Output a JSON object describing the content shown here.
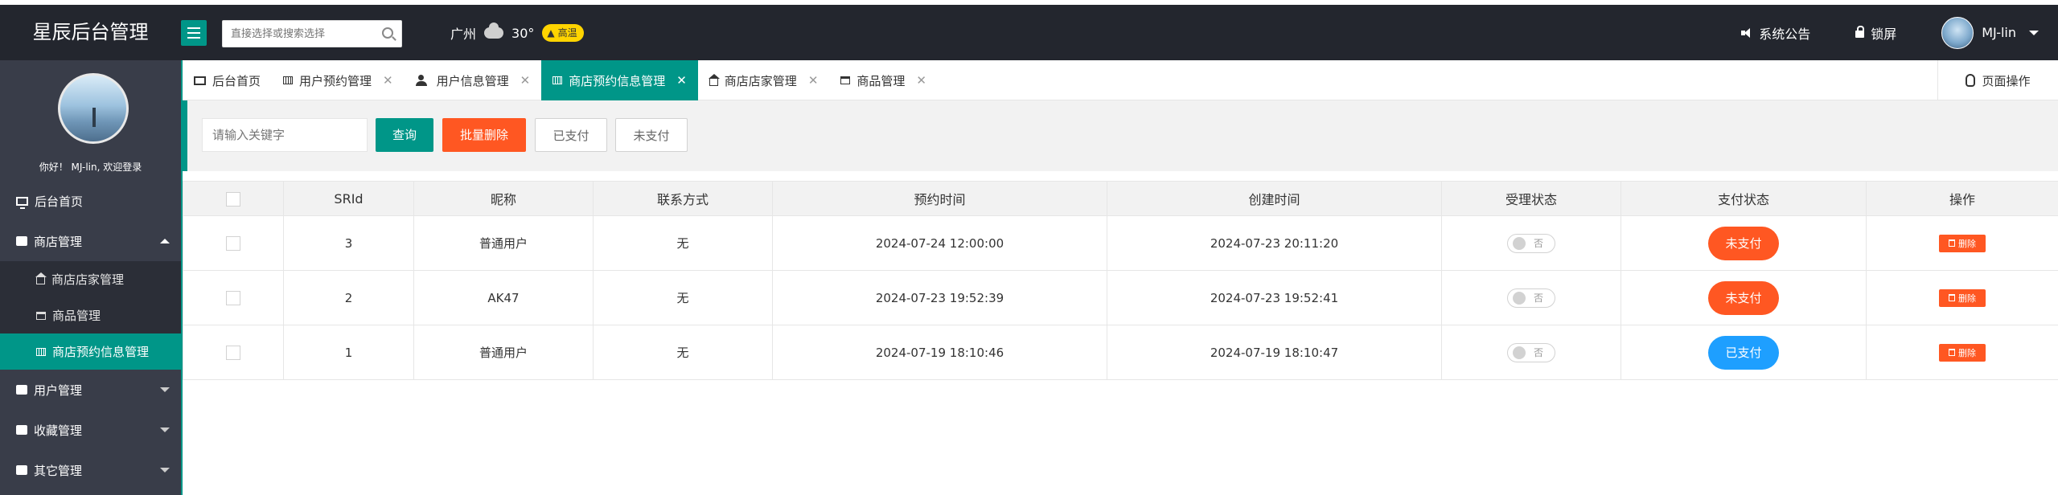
{
  "app": {
    "title": "星辰后台管理"
  },
  "search": {
    "placeholder": "直接选择或搜索选择"
  },
  "weather": {
    "city": "广州",
    "temp": "30°",
    "badge": "高温"
  },
  "header": {
    "announcement": "系统公告",
    "lock": "锁屏",
    "user": "MJ-lin"
  },
  "profile": {
    "greeting": "你好！ MJ-lin, 欢迎登录"
  },
  "sidebar": {
    "items": [
      {
        "label": "后台首页"
      },
      {
        "label": "商店管理",
        "children": [
          "商店店家管理",
          "商品管理",
          "商店预约信息管理"
        ]
      },
      {
        "label": "用户管理"
      },
      {
        "label": "收藏管理"
      },
      {
        "label": "其它管理"
      }
    ]
  },
  "tabs": [
    {
      "label": "后台首页"
    },
    {
      "label": "用户预约管理"
    },
    {
      "label": "用户信息管理"
    },
    {
      "label": "商店预约信息管理"
    },
    {
      "label": "商店店家管理"
    },
    {
      "label": "商品管理"
    }
  ],
  "page_ops": "页面操作",
  "toolbar": {
    "keyword_placeholder": "请输入关键字",
    "query": "查询",
    "batch_delete": "批量删除",
    "paid": "已支付",
    "unpaid": "未支付"
  },
  "table": {
    "headers": [
      "SRId",
      "昵称",
      "联系方式",
      "预约时间",
      "创建时间",
      "受理状态",
      "支付状态",
      "操作"
    ],
    "rows": [
      {
        "id": "3",
        "nickname": "普通用户",
        "contact": "无",
        "reserve_time": "2024-07-24 12:00:00",
        "create_time": "2024-07-23 20:11:20",
        "accept": "否",
        "pay_status": "未支付",
        "action": "删除"
      },
      {
        "id": "2",
        "nickname": "AK47",
        "contact": "无",
        "reserve_time": "2024-07-23 19:52:39",
        "create_time": "2024-07-23 19:52:41",
        "accept": "否",
        "pay_status": "未支付",
        "action": "删除"
      },
      {
        "id": "1",
        "nickname": "普通用户",
        "contact": "无",
        "reserve_time": "2024-07-19 18:10:46",
        "create_time": "2024-07-19 18:10:47",
        "accept": "否",
        "pay_status": "已支付",
        "action": "删除"
      }
    ]
  },
  "colors": {
    "accent": "#009688",
    "danger": "#ff5722",
    "info": "#1e9fff",
    "topbar": "#23262e",
    "sidebar": "#393d49"
  }
}
